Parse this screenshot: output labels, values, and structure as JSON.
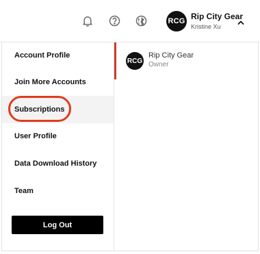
{
  "topbar": {
    "icons": [
      "bell-icon",
      "help-icon",
      "globe-icon"
    ],
    "account": {
      "avatar_initials": "RCG",
      "name": "Rip City Gear",
      "user": "Kristine Xu",
      "chevron": "chevron-up-icon"
    }
  },
  "menu": {
    "items": [
      {
        "label": "Account Profile"
      },
      {
        "label": "Join More Accounts"
      },
      {
        "label": "Subscriptions"
      },
      {
        "label": "User Profile"
      },
      {
        "label": "Data Download History"
      },
      {
        "label": "Team"
      }
    ],
    "selected_index": 2,
    "logout_label": "Log Out"
  },
  "accounts": [
    {
      "initials": "RCG",
      "name": "Rip City Gear",
      "role": "Owner"
    }
  ],
  "colors": {
    "accent_red": "#e23a1b",
    "selected_bar": "#d23a2a",
    "button_bg": "#000000",
    "avatar_bg": "#111111"
  }
}
